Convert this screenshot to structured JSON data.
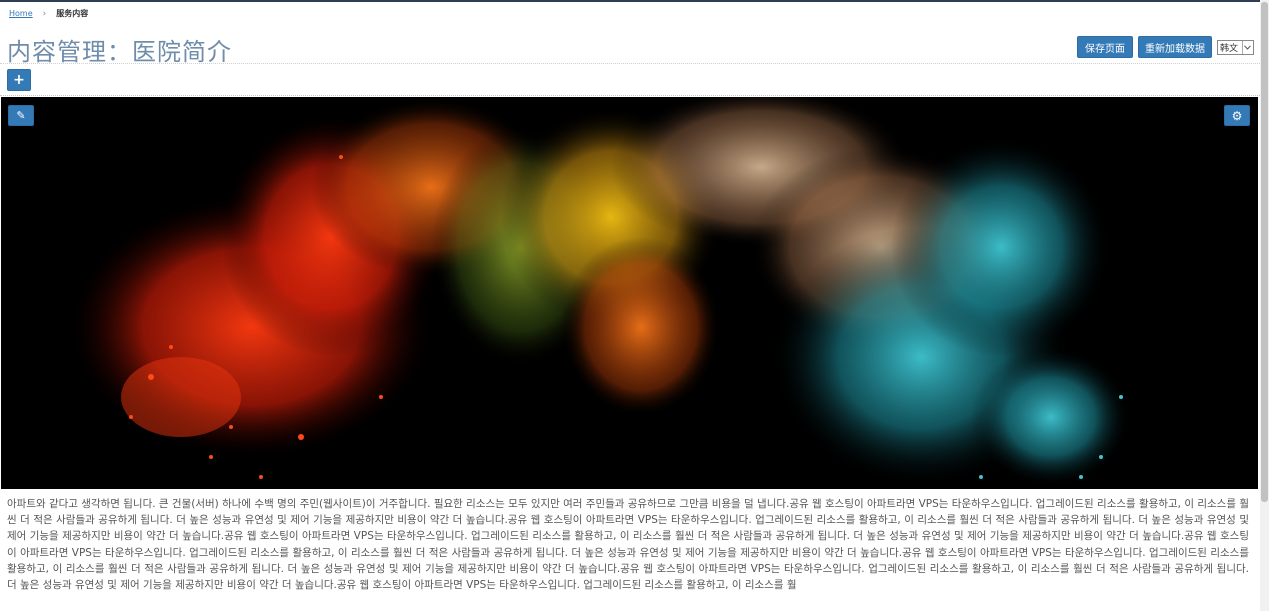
{
  "breadcrumb": {
    "home": "Home",
    "separator": "›",
    "current": "服务内容"
  },
  "header": {
    "title": "内容管理：医院简介",
    "save_label": "保存页面",
    "reload_label": "重新加载数据",
    "language": {
      "selected": "韩文"
    }
  },
  "toolbar": {
    "add_label": "+"
  },
  "hero": {
    "edit_label": "✎",
    "settings_label": "⚙"
  },
  "content": {
    "paragraph": "아파트와 같다고 생각하면 됩니다. 큰 건물(서버) 하나에 수백 명의 주민(웹사이트)이 거주합니다. 필요한 리소스는 모두 있지만 여러 주민들과 공유하므로 그만큼 비용을 덜 냅니다.공유 웹 호스팅이 아파트라면 VPS는 타운하우스입니다. 업그레이드된 리소스를 활용하고, 이 리소스를 훨씬 더 적은 사람들과 공유하게 됩니다. 더 높은 성능과 유연성 및 제어 기능을 제공하지만 비용이 약간 더 높습니다.공유 웹 호스팅이 아파트라면 VPS는 타운하우스입니다. 업그레이드된 리소스를 활용하고, 이 리소스를 훨씬 더 적은 사람들과 공유하게 됩니다. 더 높은 성능과 유연성 및 제어 기능을 제공하지만 비용이 약간 더 높습니다.공유 웹 호스팅이 아파트라면 VPS는 타운하우스입니다. 업그레이드된 리소스를 활용하고, 이 리소스를 훨씬 더 적은 사람들과 공유하게 됩니다. 더 높은 성능과 유연성 및 제어 기능을 제공하지만 비용이 약간 더 높습니다.공유 웹 호스팅이 아파트라면 VPS는 타운하우스입니다. 업그레이드된 리소스를 활용하고, 이 리소스를 훨씬 더 적은 사람들과 공유하게 됩니다. 더 높은 성능과 유연성 및 제어 기능을 제공하지만 비용이 약간 더 높습니다.공유 웹 호스팅이 아파트라면 VPS는 타운하우스입니다. 업그레이드된 리소스를 활용하고, 이 리소스를 훨씬 더 적은 사람들과 공유하게 됩니다. 더 높은 성능과 유연성 및 제어 기능을 제공하지만 비용이 약간 더 높습니다.공유 웹 호스팅이 아파트라면 VPS는 타운하우스입니다. 업그레이드된 리소스를 활용하고, 이 리소스를 훨씬 더 적은 사람들과 공유하게 됩니다. 더 높은 성능과 유연성 및 제어 기능을 제공하지만 비용이 약간 더 높습니다.공유 웹 호스팅이 아파트라면 VPS는 타운하우스입니다. 업그레이드된 리소스를 활용하고, 이 리소스를 훨"
  },
  "icons": {
    "add": "plus-icon",
    "edit": "edit-icon",
    "settings": "gear-icon",
    "dropdown": "chevron-down-icon"
  },
  "colors": {
    "accent": "#337ab7",
    "title": "#6f8cab",
    "hero_background": "#000000"
  }
}
